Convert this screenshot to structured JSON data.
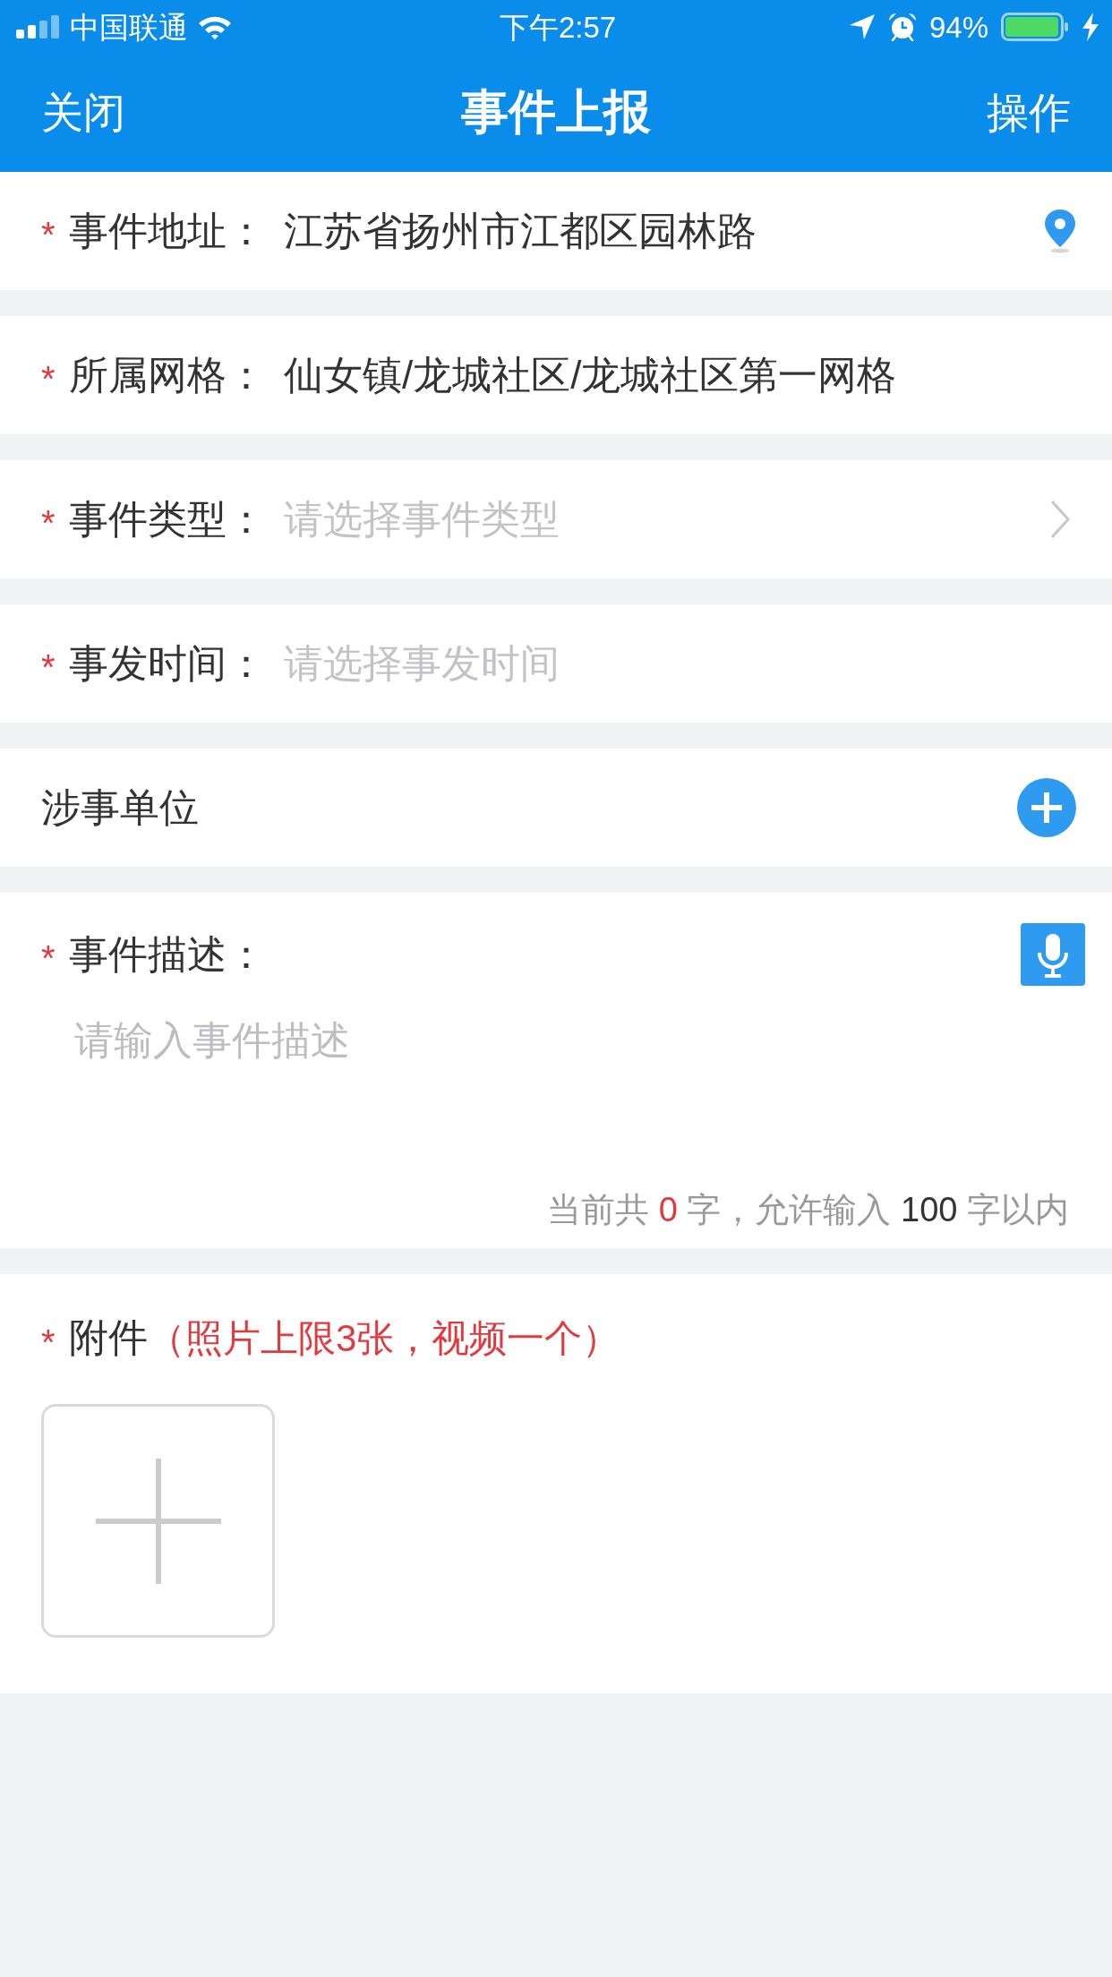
{
  "status_bar": {
    "carrier": "中国联通",
    "time": "下午2:57",
    "battery": "94%"
  },
  "nav_bar": {
    "left_button": "关闭",
    "title": "事件上报",
    "right_button": "操作"
  },
  "fields": [
    {
      "kind": "location",
      "mark": "*",
      "label": "事件地址：",
      "value": "江苏省扬州市江都区园林路"
    },
    {
      "kind": "text",
      "mark": "*",
      "label": "所属网格：",
      "value": "仙女镇/龙城社区/龙城社区第一网格"
    },
    {
      "kind": "select",
      "mark": "*",
      "label": "事件类型：",
      "placeholder": "请选择事件类型"
    },
    {
      "kind": "datetime",
      "mark": "*",
      "label": "事发时间：",
      "placeholder": "请选择事发时间"
    },
    {
      "kind": "add",
      "label": "涉事单位"
    }
  ],
  "description": {
    "mark": "*",
    "label": "事件描述：",
    "placeholder": "请输入事件描述",
    "counter": {
      "before": "当前共",
      "count": "0",
      "between": "字，允许输入",
      "limit": "100",
      "after": "字以内"
    }
  },
  "attachments": {
    "mark": "*",
    "label": "附件",
    "note": "（照片上限3张，视频一个）"
  }
}
